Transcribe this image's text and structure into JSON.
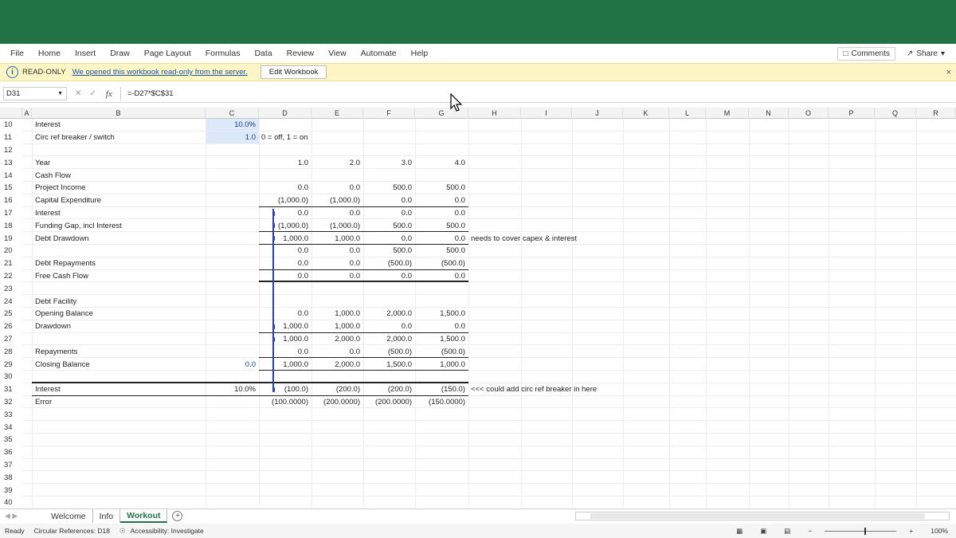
{
  "ribbon": {
    "tabs": [
      "File",
      "Home",
      "Insert",
      "Draw",
      "Page Layout",
      "Formulas",
      "Data",
      "Review",
      "View",
      "Automate",
      "Help"
    ],
    "comments_label": "Comments",
    "share_label": "Share"
  },
  "notice": {
    "status": "READ-ONLY",
    "message": "We opened this workbook read-only from the server.",
    "edit_button": "Edit Workbook"
  },
  "formula_bar": {
    "name_box": "D31",
    "formula": "=-D27*$C$31"
  },
  "columns": [
    "A",
    "B",
    "C",
    "D",
    "E",
    "F",
    "G",
    "H",
    "I",
    "J",
    "K",
    "L",
    "M",
    "N",
    "O",
    "P",
    "Q",
    "R"
  ],
  "rows": [
    "10",
    "11",
    "12",
    "13",
    "14",
    "15",
    "16",
    "17",
    "18",
    "19",
    "20",
    "21",
    "22",
    "23",
    "24",
    "25",
    "26",
    "27",
    "28",
    "29",
    "30",
    "31",
    "32",
    "33",
    "34",
    "35",
    "36",
    "37",
    "38",
    "39",
    "40"
  ],
  "labels": {
    "interest": "Interest",
    "circ": "Circ ref breaker / switch",
    "year": "Year",
    "cash_flow": "Cash Flow",
    "project_income": "Project Income",
    "capex": "Capital Expenditure",
    "interest17": "Interest",
    "funding_gap": "Funding Gap, incl Interest",
    "debt_drawdown": "Debt Drawdown",
    "debt_repayments": "Debt Repayments",
    "fcf": "Free Cash Flow",
    "debt_facility": "Debt Facility",
    "opening_balance": "Opening Balance",
    "drawdown": "Drawdown",
    "repayments": "Repayments",
    "closing_balance": "Closing Balance",
    "interest31": "Interest",
    "error": "Error"
  },
  "inputs": {
    "c10": "10.0%",
    "c11": "1.0",
    "d11_note": "0 = off, 1 = on",
    "c29": "0.0",
    "c31": "10.0%"
  },
  "values": {
    "r13": [
      "1.0",
      "2.0",
      "3.0",
      "4.0"
    ],
    "r15": [
      "0.0",
      "0.0",
      "500.0",
      "500.0"
    ],
    "r16": [
      "(1,000.0)",
      "(1,000.0)",
      "0.0",
      "0.0"
    ],
    "r17": [
      "0.0",
      "0.0",
      "0.0",
      "0.0"
    ],
    "r18": [
      "(1,000.0)",
      "(1,000.0)",
      "500.0",
      "500.0"
    ],
    "r19": [
      "1,000.0",
      "1,000.0",
      "0.0",
      "0.0"
    ],
    "r20": [
      "0.0",
      "0.0",
      "500.0",
      "500.0"
    ],
    "r21": [
      "0.0",
      "0.0",
      "(500.0)",
      "(500.0)"
    ],
    "r22": [
      "0.0",
      "0.0",
      "0.0",
      "0.0"
    ],
    "r25": [
      "0.0",
      "1,000.0",
      "2,000.0",
      "1,500.0"
    ],
    "r26": [
      "1,000.0",
      "1,000.0",
      "0.0",
      "0.0"
    ],
    "r27": [
      "1,000.0",
      "2,000.0",
      "2,000.0",
      "1,500.0"
    ],
    "r28": [
      "0.0",
      "0.0",
      "(500.0)",
      "(500.0)"
    ],
    "r29": [
      "1,000.0",
      "2,000.0",
      "1,500.0",
      "1,000.0"
    ],
    "r31": [
      "(100.0)",
      "(200.0)",
      "(200.0)",
      "(150.0)"
    ],
    "r32": [
      "(100.0000)",
      "(200.0000)",
      "(200.0000)",
      "(150.0000)"
    ]
  },
  "notes": {
    "h19": "needs to cover capex & interest",
    "h31": "<<< could add circ ref breaker in here"
  },
  "sheet_tabs": [
    "Welcome",
    "Info",
    "Workout"
  ],
  "active_sheet": "Workout",
  "status": {
    "ready": "Ready",
    "circular": "Circular References: D18",
    "accessibility": "Accessibility: Investigate",
    "zoom": "100%"
  },
  "colors": {
    "brand": "#217346",
    "tracer": "#2a3fb5",
    "input_highlight": "#dbe9f8",
    "notice_bg": "#fdf6c4"
  }
}
